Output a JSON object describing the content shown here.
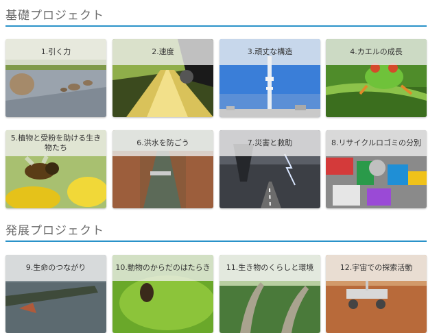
{
  "sections": [
    {
      "title": "基礎プロジェクト",
      "cards": [
        {
          "label": "1.引く力",
          "icon": "rock-image"
        },
        {
          "label": "2.速度",
          "icon": "speed-car-image"
        },
        {
          "label": "3.頑丈な構造",
          "icon": "tower-image"
        },
        {
          "label": "4.カエルの成長",
          "icon": "frog-image"
        },
        {
          "label": "5.植物と受粉を助ける生き物たち",
          "icon": "bee-flower-image"
        },
        {
          "label": "6.洪水を防ごう",
          "icon": "canal-image"
        },
        {
          "label": "7.災害と救助",
          "icon": "tornado-image"
        },
        {
          "label": "8.リサイクルロゴミの分別",
          "icon": "trash-image"
        }
      ]
    },
    {
      "title": "発展プロジェクト",
      "cards": [
        {
          "label": "9.生命のつながり",
          "icon": "crocodile-image"
        },
        {
          "label": "10.動物のからだのはたらき",
          "icon": "insect-leaf-image"
        },
        {
          "label": "11.生き物のくらしと環境",
          "icon": "dinosaur-image"
        },
        {
          "label": "12.宇宙での探索活動",
          "icon": "rover-image"
        }
      ]
    }
  ]
}
